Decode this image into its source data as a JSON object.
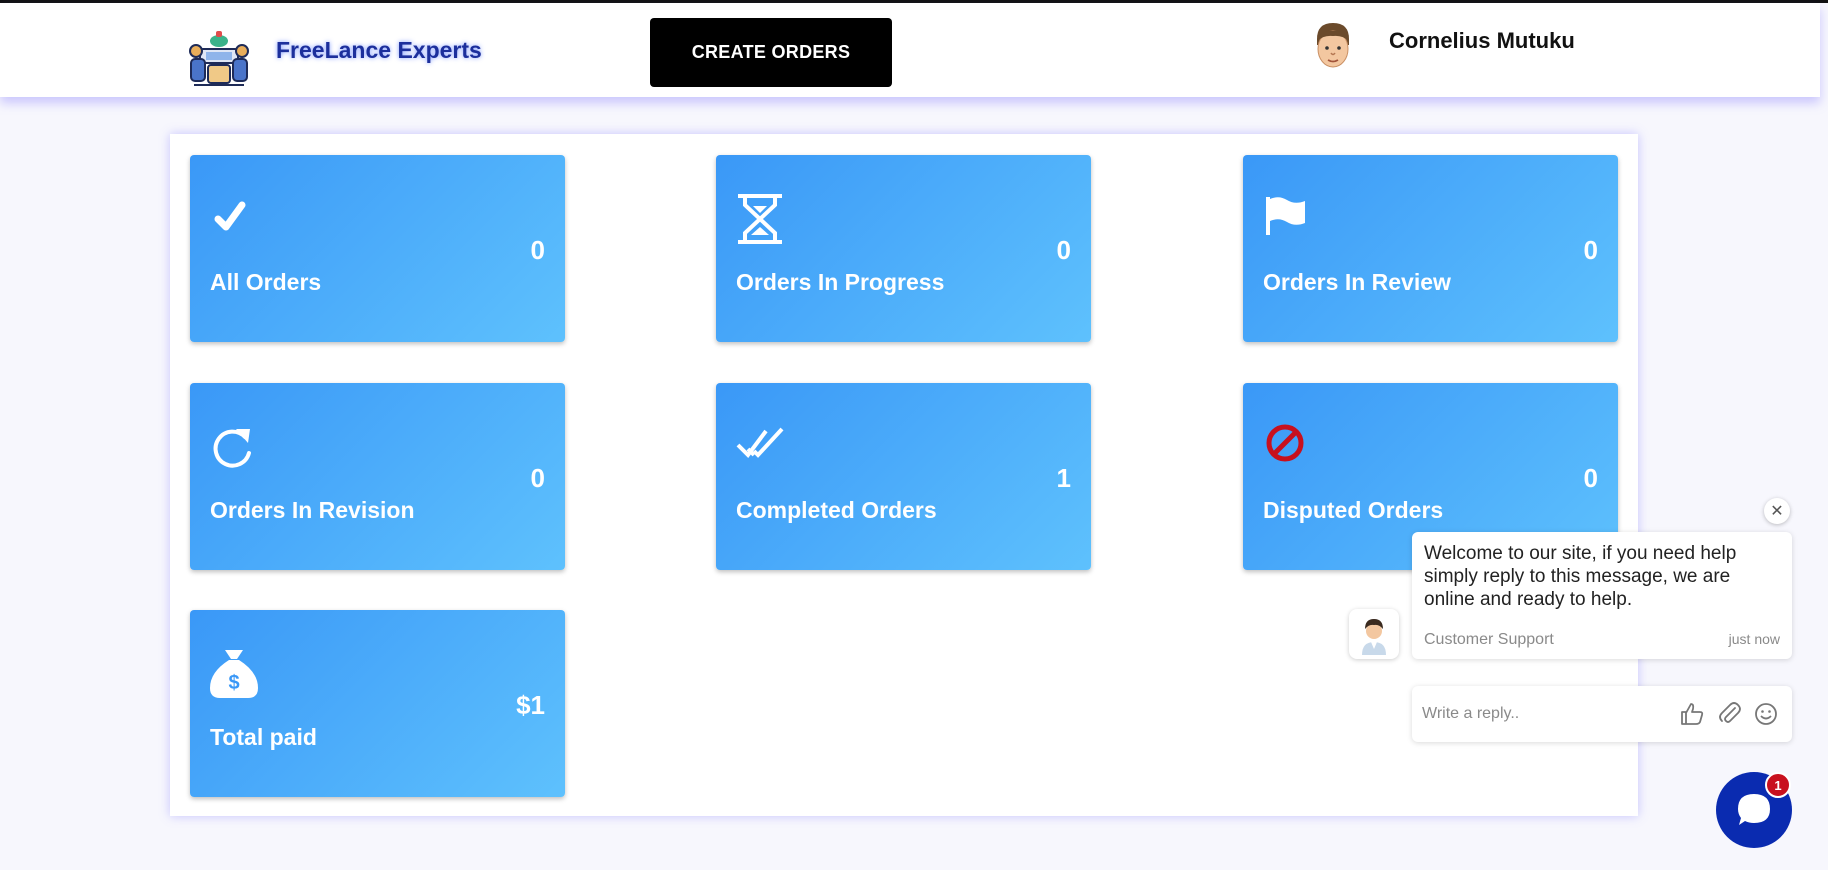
{
  "header": {
    "brand": "FreeLance Experts",
    "create_button": "CREATE ORDERS",
    "user_name": "Cornelius Mutuku"
  },
  "colors": {
    "card_gradient_start": "#3a98f7",
    "card_gradient_end": "#5ec1fd",
    "brand_text": "#1c2f9c",
    "disputed_icon": "#c8101e",
    "chat_launcher": "#0a2bb0"
  },
  "cards": [
    {
      "label": "All Orders",
      "value": "0",
      "icon": "check-icon"
    },
    {
      "label": "Orders In Progress",
      "value": "0",
      "icon": "hourglass-icon"
    },
    {
      "label": "Orders In Review",
      "value": "0",
      "icon": "flag-icon"
    },
    {
      "label": "Orders In Revision",
      "value": "0",
      "icon": "refresh-icon"
    },
    {
      "label": "Completed Orders",
      "value": "1",
      "icon": "double-check-icon"
    },
    {
      "label": "Disputed Orders",
      "value": "0",
      "icon": "ban-icon"
    },
    {
      "label": "Total paid",
      "value": "$1",
      "icon": "money-bag-icon"
    }
  ],
  "chat": {
    "message": "Welcome to our site, if you need help simply reply to this message, we are online and ready to help.",
    "from": "Customer Support",
    "time": "just now",
    "reply_placeholder": "Write a reply..",
    "badge_count": "1"
  }
}
